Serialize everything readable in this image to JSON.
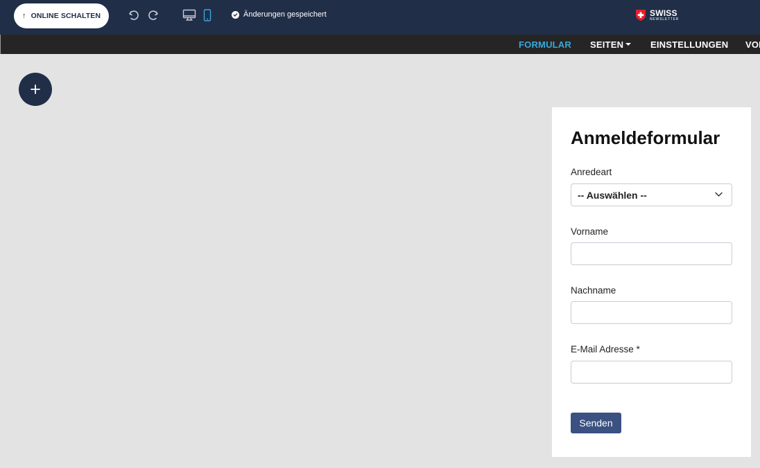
{
  "topbar": {
    "online_button": "ONLINE SCHALTEN",
    "saved_status": "Änderungen gespeichert",
    "logo_main": "SWISS",
    "logo_sub": "NEWSLETTER",
    "colors": {
      "background": "#212e48",
      "active_device": "#39a9dc"
    }
  },
  "menu": {
    "items": [
      {
        "label": "FORMULAR",
        "active": true
      },
      {
        "label": "SEITEN",
        "dropdown": true
      },
      {
        "label": "EINSTELLUNGEN"
      },
      {
        "label": "VOR"
      }
    ]
  },
  "canvas": {
    "add_button": "+"
  },
  "form": {
    "title": "Anmeldeformular",
    "fields": [
      {
        "label": "Anredeart",
        "type": "select",
        "value": "-- Auswählen --"
      },
      {
        "label": "Vorname",
        "type": "text",
        "value": ""
      },
      {
        "label": "Nachname",
        "type": "text",
        "value": ""
      },
      {
        "label": "E-Mail Adresse *",
        "type": "email",
        "value": ""
      }
    ],
    "submit_label": "Senden",
    "colors": {
      "submit": "#3a5181"
    }
  }
}
